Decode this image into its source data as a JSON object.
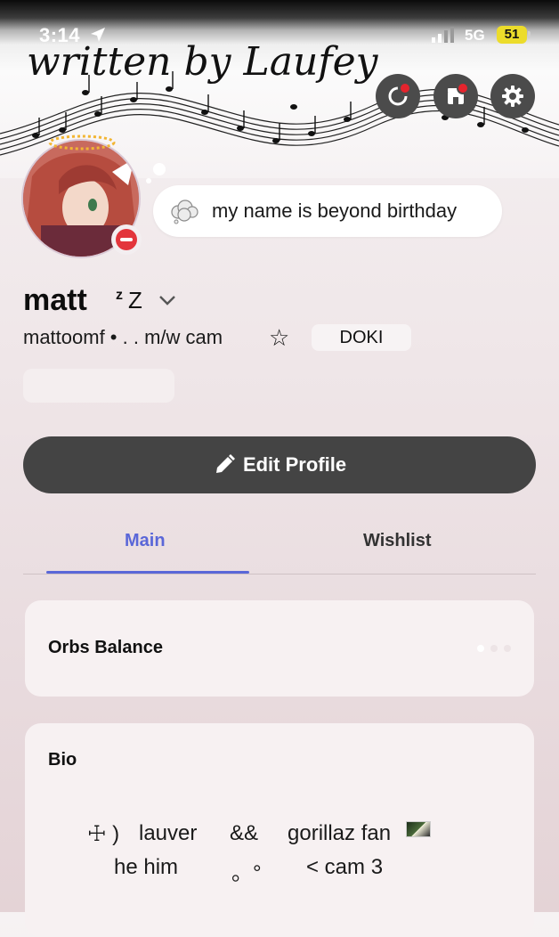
{
  "status_bar": {
    "time": "3:14",
    "network": "5G",
    "battery": "51"
  },
  "banner": {
    "text": "written by Laufey"
  },
  "header_buttons": [
    {
      "icon": "nitro-refresh-icon",
      "has_notification": true
    },
    {
      "icon": "shop-icon",
      "has_notification": true
    },
    {
      "icon": "gear-icon",
      "has_notification": false
    }
  ],
  "profile": {
    "display_name": "matt",
    "status_icon": "z Z",
    "username_line": "mattoomf • . . m/w cam",
    "tag": "DOKI",
    "custom_status": "my name is beyond birthday",
    "presence": "do-not-disturb"
  },
  "edit_button": {
    "label": "Edit Profile"
  },
  "tabs": [
    {
      "label": "Main",
      "active": true
    },
    {
      "label": "Wishlist",
      "active": false
    }
  ],
  "orbs": {
    "title": "Orbs Balance"
  },
  "bio": {
    "title": "Bio",
    "line1_a": "☩ )",
    "line1_b": "lauver",
    "line1_c": "&&",
    "line1_d": "gorillaz fan",
    "line2_a": "he  him",
    "line2_b": "。°",
    "line2_c": "< cam 3"
  },
  "colors": {
    "accent": "#5a67d8",
    "button_dark": "#444444",
    "dnd_red": "#e3353c",
    "notification_red": "#e5242d",
    "battery_yellow": "#ecdc2b"
  }
}
